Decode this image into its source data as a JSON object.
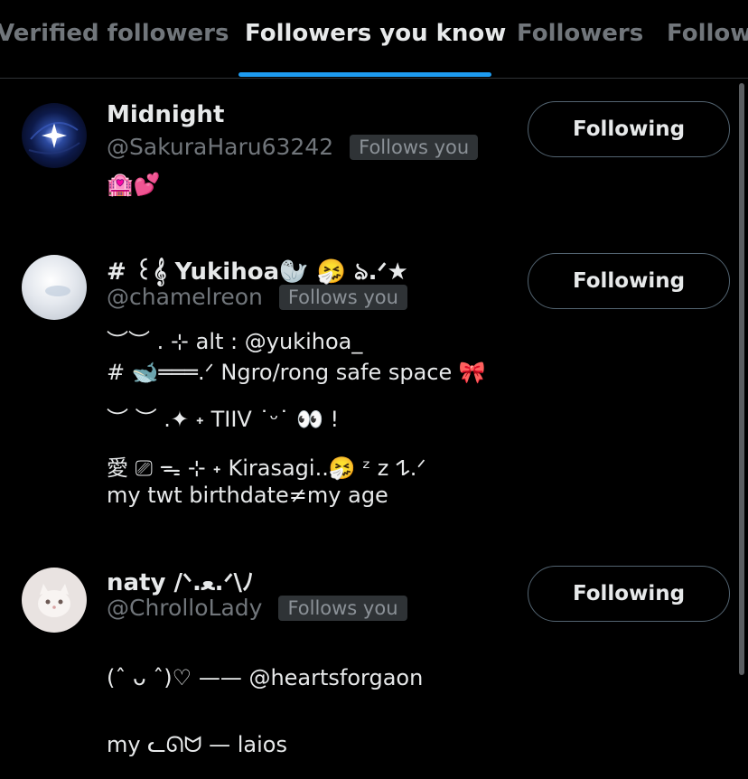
{
  "tabs": [
    {
      "label": "Verified followers",
      "active": false
    },
    {
      "label": "Followers you know",
      "active": true
    },
    {
      "label": "Followers",
      "active": false
    },
    {
      "label": "Followi",
      "active": false
    }
  ],
  "colors": {
    "accent": "#1d9bf0",
    "background": "#000000",
    "text": "#e7e9ea",
    "muted": "#71767b"
  },
  "users": [
    {
      "name": "Midnight",
      "handle": "@SakuraHaru63242",
      "badge": "Follows you",
      "button": "Following",
      "bio": [
        "🏩💕"
      ]
    },
    {
      "name": "# ꒰𝄞 Yukihoa🦭 🤧 ঌ.ᐟ★",
      "handle": "@chamelreon",
      "badge": "Follows you",
      "button": "Following",
      "bio": [
        "︶︶ . ⊹ alt : @yukihoa_",
        "# 🐋═══.ᐟ Ngro/rong safe space 🎀",
        "︶ ︶ .✦ ˖ TIIV ˙ᵕ˙ 👀 !",
        "愛 ⎚ ᯓ ⊹ ˖ Kirasagi..🤧 ᶻ z 𐰁.ᐟ",
        "my twt birthdate≠my age"
      ]
    },
    {
      "name": "naty /ᐠ.ﻌ.ᐟ\\ﾉ",
      "handle": "@ChrolloLady",
      "badge": "Follows you",
      "button": "Following",
      "bio": [
        "(ˆ ᴗ ˆ)♡ —— @heartsforgaon",
        "my ᓚᘏᗢ — laios"
      ]
    }
  ]
}
